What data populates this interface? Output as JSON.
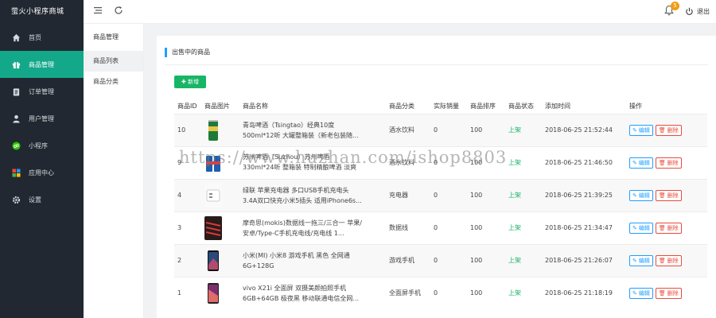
{
  "app": {
    "title": "萤火小程序商城"
  },
  "colors": {
    "sidebar_bg": "#222831",
    "active": "#14a88a",
    "accent": "#1e9fff",
    "success": "#18b566",
    "danger": "#e74c3c",
    "badge": "#f39c12"
  },
  "sidebar": {
    "items": [
      {
        "label": "首页",
        "icon": "home-icon"
      },
      {
        "label": "商品管理",
        "icon": "gift-icon",
        "active": true
      },
      {
        "label": "订单管理",
        "icon": "clipboard-icon"
      },
      {
        "label": "用户管理",
        "icon": "user-icon"
      },
      {
        "label": "小程序",
        "icon": "miniprogram-icon"
      },
      {
        "label": "应用中心",
        "icon": "apps-icon"
      },
      {
        "label": "设置",
        "icon": "gear-icon"
      }
    ]
  },
  "subnav": {
    "title": "商品管理",
    "items": [
      {
        "label": "商品列表",
        "active": true
      },
      {
        "label": "商品分类"
      }
    ]
  },
  "topbar": {
    "notification_count": "5",
    "logout_label": "退出"
  },
  "panel": {
    "title": "出售中的商品",
    "add_label": "新增"
  },
  "table": {
    "headers": [
      "商品ID",
      "商品图片",
      "商品名称",
      "商品分类",
      "实际销量",
      "商品排序",
      "商品状态",
      "添加时间",
      "操作"
    ],
    "rows": [
      {
        "id": "10",
        "image": "beer-can-image",
        "name": "青岛啤酒（Tsingtao）经典10度 500ml*12听 大罐整箱装（新老包装随...",
        "category": "酒水饮料",
        "sales": "0",
        "sort": "100",
        "status": "上架",
        "added": "2018-06-25 21:52:44"
      },
      {
        "id": "9",
        "image": "beer-cans-image",
        "name": "苏州啤酒（Suzhou）苏州啤酒 330ml*24听 整箱装 特制精酿啤酒 淡爽啤酒 口感醇厚",
        "category": "酒水饮料",
        "sales": "0",
        "sort": "100",
        "status": "上架",
        "added": "2018-06-25 21:46:50"
      },
      {
        "id": "4",
        "image": "charger-image",
        "name": "绿联 苹果充电器 多口USB手机充电头 3.4A双口快充小米5插头 适用iPhone6s...",
        "category": "充电器",
        "sales": "0",
        "sort": "100",
        "status": "上架",
        "added": "2018-06-25 21:39:25"
      },
      {
        "id": "3",
        "image": "cables-image",
        "name": "摩奇思(mokis)数据线一拖三/三合一 苹果/安卓/Type-C手机充电线/充电线 1...",
        "category": "数据线",
        "sales": "0",
        "sort": "100",
        "status": "上架",
        "added": "2018-06-25 21:34:47"
      },
      {
        "id": "2",
        "image": "phone-image",
        "name": "小米(MI) 小米8 游戏手机 黑色 全网通 6G+128G",
        "category": "游戏手机",
        "sales": "0",
        "sort": "100",
        "status": "上架",
        "added": "2018-06-25 21:26:07"
      },
      {
        "id": "1",
        "image": "vivo-phone-image",
        "name": "vivo X21i 全面屏 双摄美颜拍照手机 6GB+64GB 极夜黑 移动联通电信全网...",
        "category": "全面屏手机",
        "sales": "0",
        "sort": "100",
        "status": "上架",
        "added": "2018-06-25 21:18:19"
      }
    ],
    "edit_label": "编辑",
    "delete_label": "删除"
  },
  "watermark": "https://www.huzhan.com/ishop8803"
}
